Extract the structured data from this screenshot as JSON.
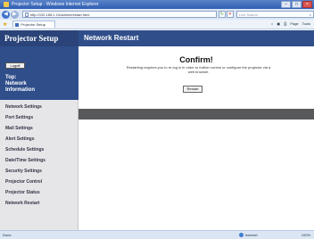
{
  "window": {
    "title": "Projector Setup - Windows Internet Explorer",
    "minimize": "–",
    "maximize": "□",
    "close": "×"
  },
  "browser": {
    "back": "◀",
    "forward": "▶",
    "address": "http://192.168.1.10/admin/restart.html",
    "refresh": "↻",
    "stop": "✕",
    "search_placeholder": "Live Search",
    "search_icon": "⌕",
    "favorites_icon": "★",
    "tab_label": "Projector Setup",
    "commands": [
      "⌂",
      "▣",
      "⎙",
      "Page",
      "Tools"
    ]
  },
  "sidebar": {
    "brand": "Projector Setup",
    "logoff": "Logoff",
    "top_link": "Top:\nNetwork\nInformation",
    "items": [
      "Network Settings",
      "Port Settings",
      "Mail Settings",
      "Alert Settings",
      "Schedule Settings",
      "Date/Time Settings",
      "Security Settings",
      "Projector Control",
      "Projector Status",
      "Network Restart"
    ]
  },
  "main": {
    "header": "Network Restart",
    "title": "Confirm!",
    "message": "Restarting requires you to re-log in in order to further control or configure the projector via a web browser.",
    "restart_label": "Restart"
  },
  "status": {
    "left": "Done",
    "zone": "Internet",
    "zoom": "100%"
  }
}
